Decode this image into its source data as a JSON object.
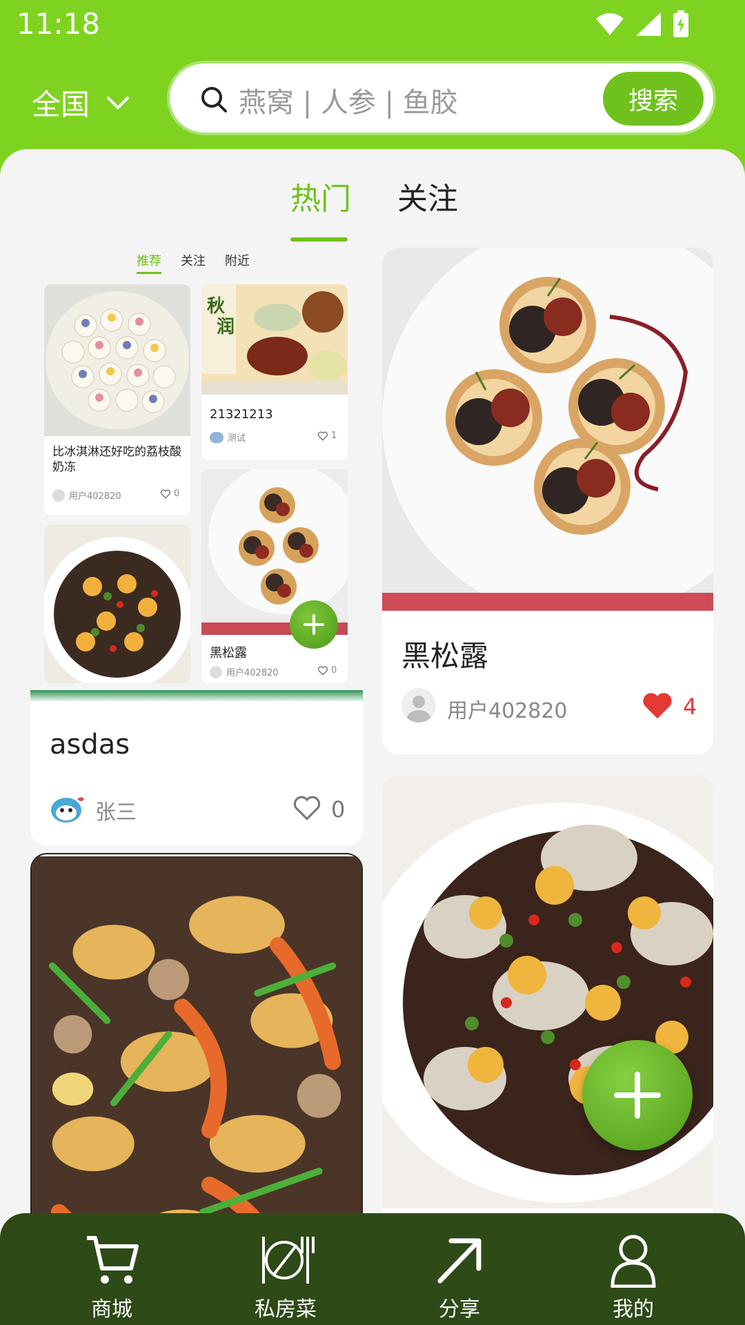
{
  "status_bar": {
    "time": "11:18"
  },
  "header": {
    "region": "全国",
    "search_placeholder": "燕窝 | 人参 | 鱼胶",
    "search_button": "搜索"
  },
  "tabs": [
    {
      "label": "热门"
    },
    {
      "label": "关注"
    }
  ],
  "screenshot_card": {
    "mini_tabs": [
      "推荐",
      "关注",
      "附近"
    ],
    "mini_items": [
      {
        "title": "比冰淇淋还好吃的荔枝酸奶冻",
        "user": "用户402820",
        "likes": "0"
      },
      {
        "title": "21321213",
        "user": "测试",
        "likes": "1"
      },
      {
        "title": "黑松露",
        "user": "用户402820",
        "likes": "0"
      }
    ],
    "title": "asdas",
    "user": "张三",
    "likes": "0"
  },
  "post_card": {
    "title": "黑松露",
    "user": "用户402820",
    "likes": "4"
  },
  "bottom_nav": [
    {
      "label": "商城",
      "icon": "cart-icon"
    },
    {
      "label": "私房菜",
      "icon": "dining-icon"
    },
    {
      "label": "分享",
      "icon": "share-arrow-icon"
    },
    {
      "label": "我的",
      "icon": "user-icon"
    }
  ],
  "colors": {
    "accent": "#7ed321",
    "nav_bg": "#2e4a17",
    "like_red": "#e53935"
  }
}
